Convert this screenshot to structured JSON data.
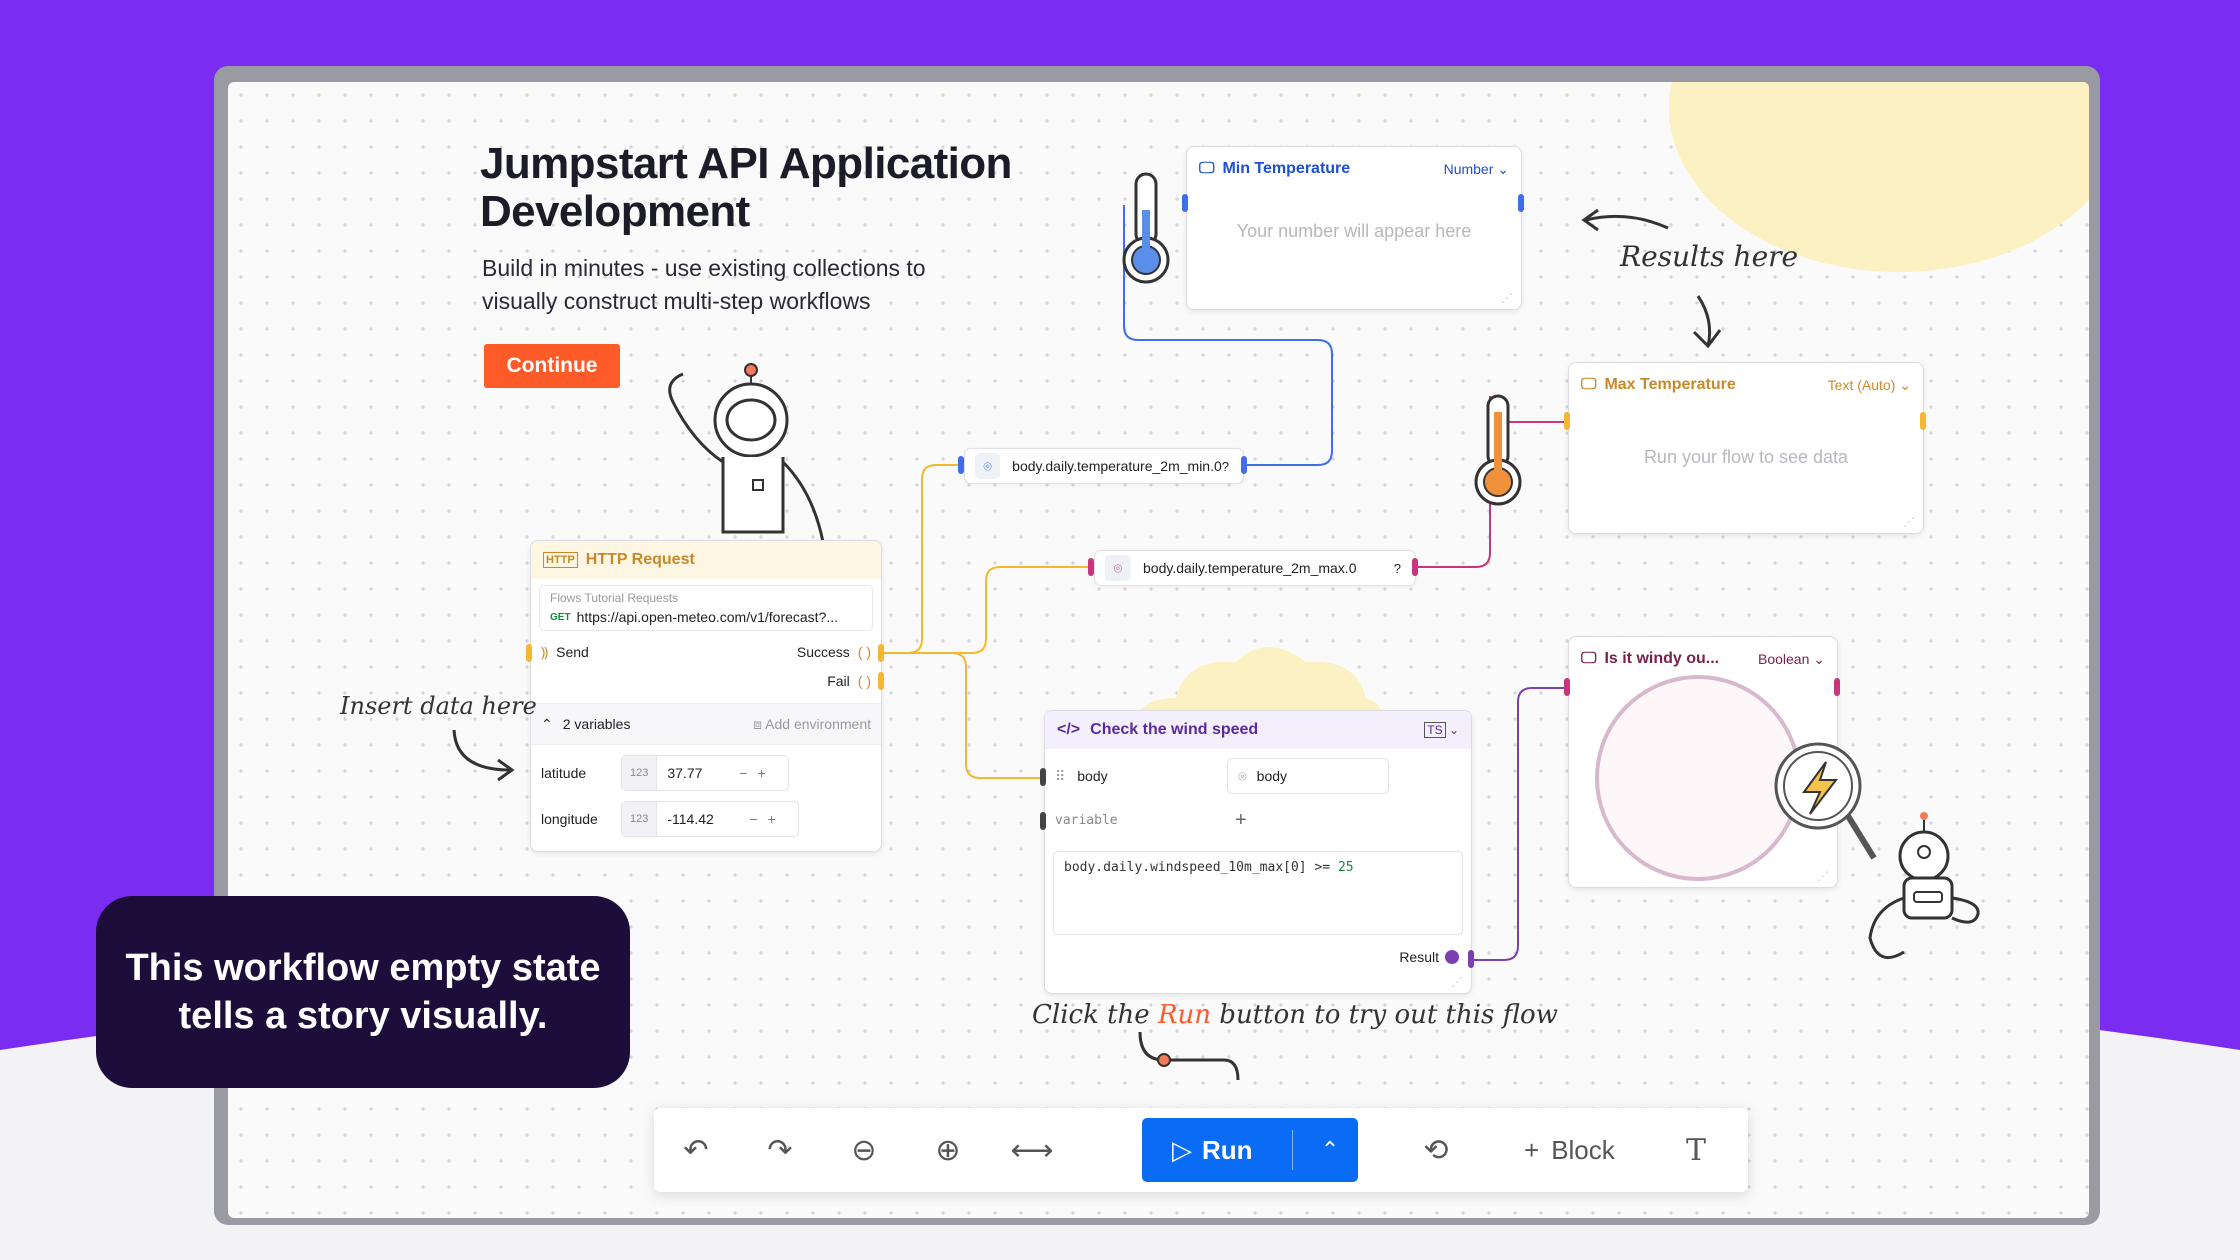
{
  "hero": {
    "title": "Jumpstart API Application Development",
    "subtitle": "Build in minutes - use existing collections to visually construct multi-step workflows",
    "cta": "Continue"
  },
  "annotations": {
    "results": "Results here",
    "insert": "Insert data here",
    "click_pre": "Click  the ",
    "click_run": "Run",
    "click_post": " button to try out this flow"
  },
  "min_temp": {
    "title": "Min Temperature",
    "type": "Number",
    "placeholder": "Your number will appear here"
  },
  "max_temp": {
    "title": "Max Temperature",
    "type": "Text (Auto)",
    "placeholder": "Run your flow to see data"
  },
  "windy": {
    "title": "Is it windy ou...",
    "type": "Boolean"
  },
  "selectors": {
    "min": "body.daily.temperature_2m_min.0",
    "max": "body.daily.temperature_2m_max.0",
    "help": "?"
  },
  "http": {
    "title": "HTTP Request",
    "collection": "Flows Tutorial Requests",
    "method": "GET",
    "url": "https://api.open-meteo.com/v1/forecast?...",
    "send": "Send",
    "success": "Success",
    "fail": "Fail",
    "variables_count": "2 variables",
    "add_env": "Add environment",
    "vars": [
      {
        "name": "latitude",
        "kind": "123",
        "value": "37.77"
      },
      {
        "name": "longitude",
        "kind": "123",
        "value": "-114.42"
      }
    ]
  },
  "script": {
    "title": "Check the wind speed",
    "input_name": "body",
    "input_value": "body",
    "variable_placeholder": "variable",
    "code_pre": "body.daily.windspeed_10m_max[0] >= ",
    "code_num": "25",
    "result": "Result"
  },
  "toolbar": {
    "run": "Run",
    "block": "Block"
  },
  "callout": {
    "line1": "This workflow empty state",
    "line2": "tells a story visually."
  },
  "colors": {
    "purple": "#7a2cf0",
    "blue": "#0a6cf5",
    "orange": "#ff5b29",
    "yellow_port": "#f5b731",
    "pink_port": "#c9357c",
    "min_accent": "#3f6ee8"
  }
}
